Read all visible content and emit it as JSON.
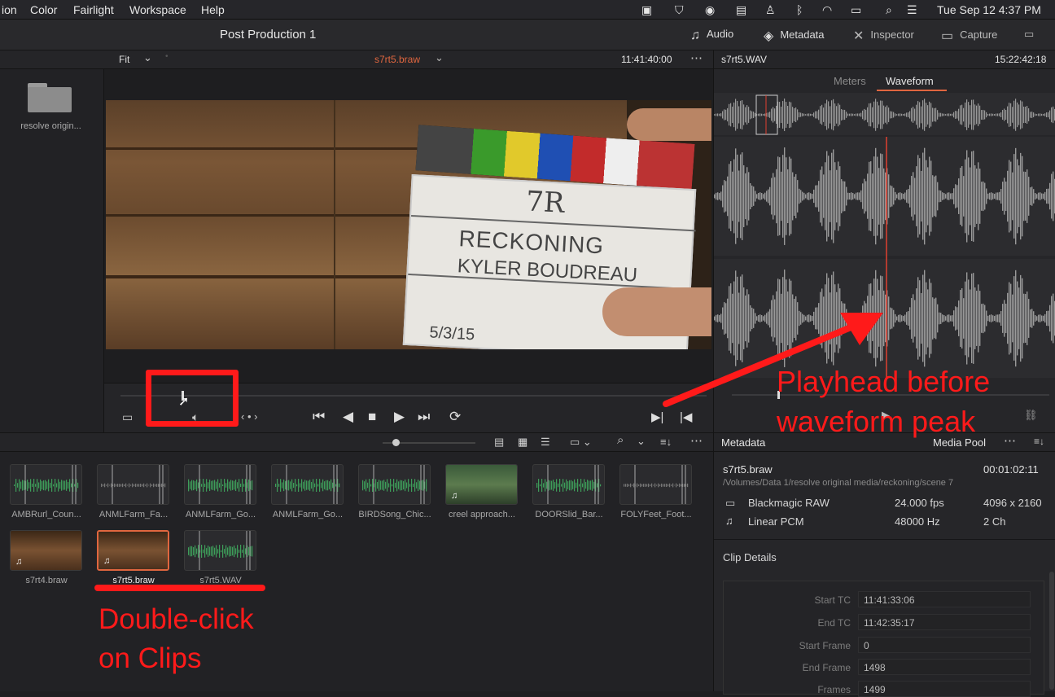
{
  "menubar": {
    "items": [
      "ion",
      "Color",
      "Fairlight",
      "Workspace",
      "Help"
    ],
    "clock": "Tue Sep 12  4:37 PM"
  },
  "titlebar": {
    "project": "Post Production 1",
    "buttons": [
      {
        "label": "Audio",
        "icon": "music-note-icon"
      },
      {
        "label": "Metadata",
        "icon": "tag-icon"
      },
      {
        "label": "Inspector",
        "icon": "inspector-icon"
      },
      {
        "label": "Capture",
        "icon": "capture-icon"
      }
    ]
  },
  "viewer": {
    "zoom": "Fit",
    "clip_name": "s7rt5.braw",
    "timecode": "11:41:40:00",
    "slate": {
      "line1": "7R",
      "line2": "RECKONING",
      "line3": "KYLER BOUDREAU",
      "date": "5/3/15"
    }
  },
  "folder": {
    "label": "resolve origin..."
  },
  "audio_panel": {
    "clip_name": "s7rt5.WAV",
    "timecode": "15:22:42:18",
    "tabs": [
      "Meters",
      "Waveform"
    ],
    "active_tab": "Waveform"
  },
  "clips": [
    {
      "label": "AMBRurl_Coun...",
      "kind": "audio"
    },
    {
      "label": "ANMLFarm_Fa...",
      "kind": "audio"
    },
    {
      "label": "ANMLFarm_Go...",
      "kind": "audio"
    },
    {
      "label": "ANMLFarm_Go...",
      "kind": "audio"
    },
    {
      "label": "BIRDSong_Chic...",
      "kind": "audio"
    },
    {
      "label": "creel approach...",
      "kind": "video"
    },
    {
      "label": "DOORSlid_Bar...",
      "kind": "audio"
    },
    {
      "label": "FOLYFeet_Foot...",
      "kind": "audio"
    },
    {
      "label": "s7rt4.braw",
      "kind": "video"
    },
    {
      "label": "s7rt5.braw",
      "kind": "video",
      "selected": true
    },
    {
      "label": "s7rt5.WAV",
      "kind": "audio"
    }
  ],
  "metadata": {
    "title": "Metadata",
    "media_pool": "Media Pool",
    "clip_name": "s7rt5.braw",
    "duration": "00:01:02:11",
    "path": "/Volumes/Data 1/resolve original media/reckoning/scene 7",
    "video": {
      "codec": "Blackmagic RAW",
      "fps": "24.000 fps",
      "resolution": "4096 x 2160"
    },
    "audio": {
      "codec": "Linear PCM",
      "rate": "48000 Hz",
      "channels": "2 Ch"
    },
    "clip_details_label": "Clip Details",
    "details": [
      {
        "key": "Start TC",
        "value": "11:41:33:06"
      },
      {
        "key": "End TC",
        "value": "11:42:35:17"
      },
      {
        "key": "Start Frame",
        "value": "0"
      },
      {
        "key": "End Frame",
        "value": "1498"
      },
      {
        "key": "Frames",
        "value": "1499"
      }
    ]
  },
  "annotations": {
    "playhead_note_line1": "Playhead before",
    "playhead_note_line2": "waveform peak",
    "dblclick_line1": "Double-click",
    "dblclick_line2": "on Clips",
    "color": "#ff1a1a"
  }
}
